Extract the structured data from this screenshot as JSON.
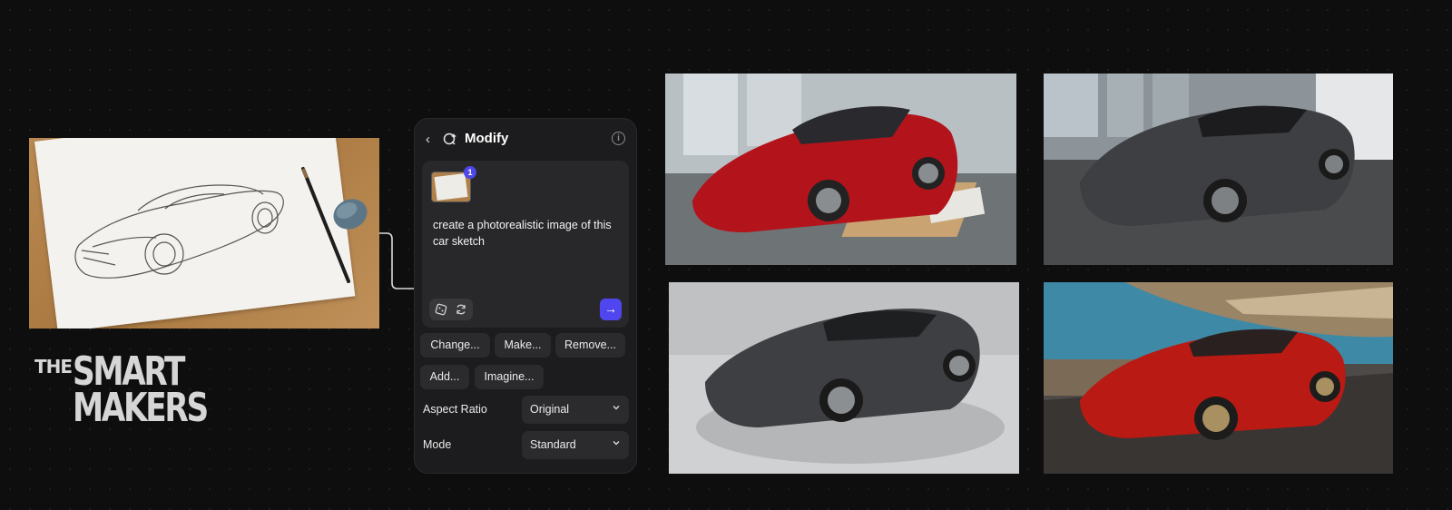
{
  "panel": {
    "title": "Modify",
    "back_icon": "chevron-left-icon",
    "title_icon": "modify-sparkle-icon",
    "info_icon": "info-icon",
    "reference_count": "1",
    "prompt": "create a photorealistic image of this car sketch",
    "send_icon": "arrow-right-icon",
    "tools": [
      "dice-icon",
      "refresh-icon"
    ],
    "quick_actions": [
      "Change...",
      "Make...",
      "Remove...",
      "Add...",
      "Imagine..."
    ],
    "options": [
      {
        "label": "Aspect Ratio",
        "value": "Original"
      },
      {
        "label": "Mode",
        "value": "Standard"
      }
    ]
  },
  "brand": {
    "the": "THE",
    "line1": "SMART",
    "line2": "MAKERS"
  },
  "colors": {
    "accent": "#5046ef",
    "panel_bg": "#1c1c1e",
    "car_red": "#b3141c",
    "car_gray": "#3e3f42"
  }
}
